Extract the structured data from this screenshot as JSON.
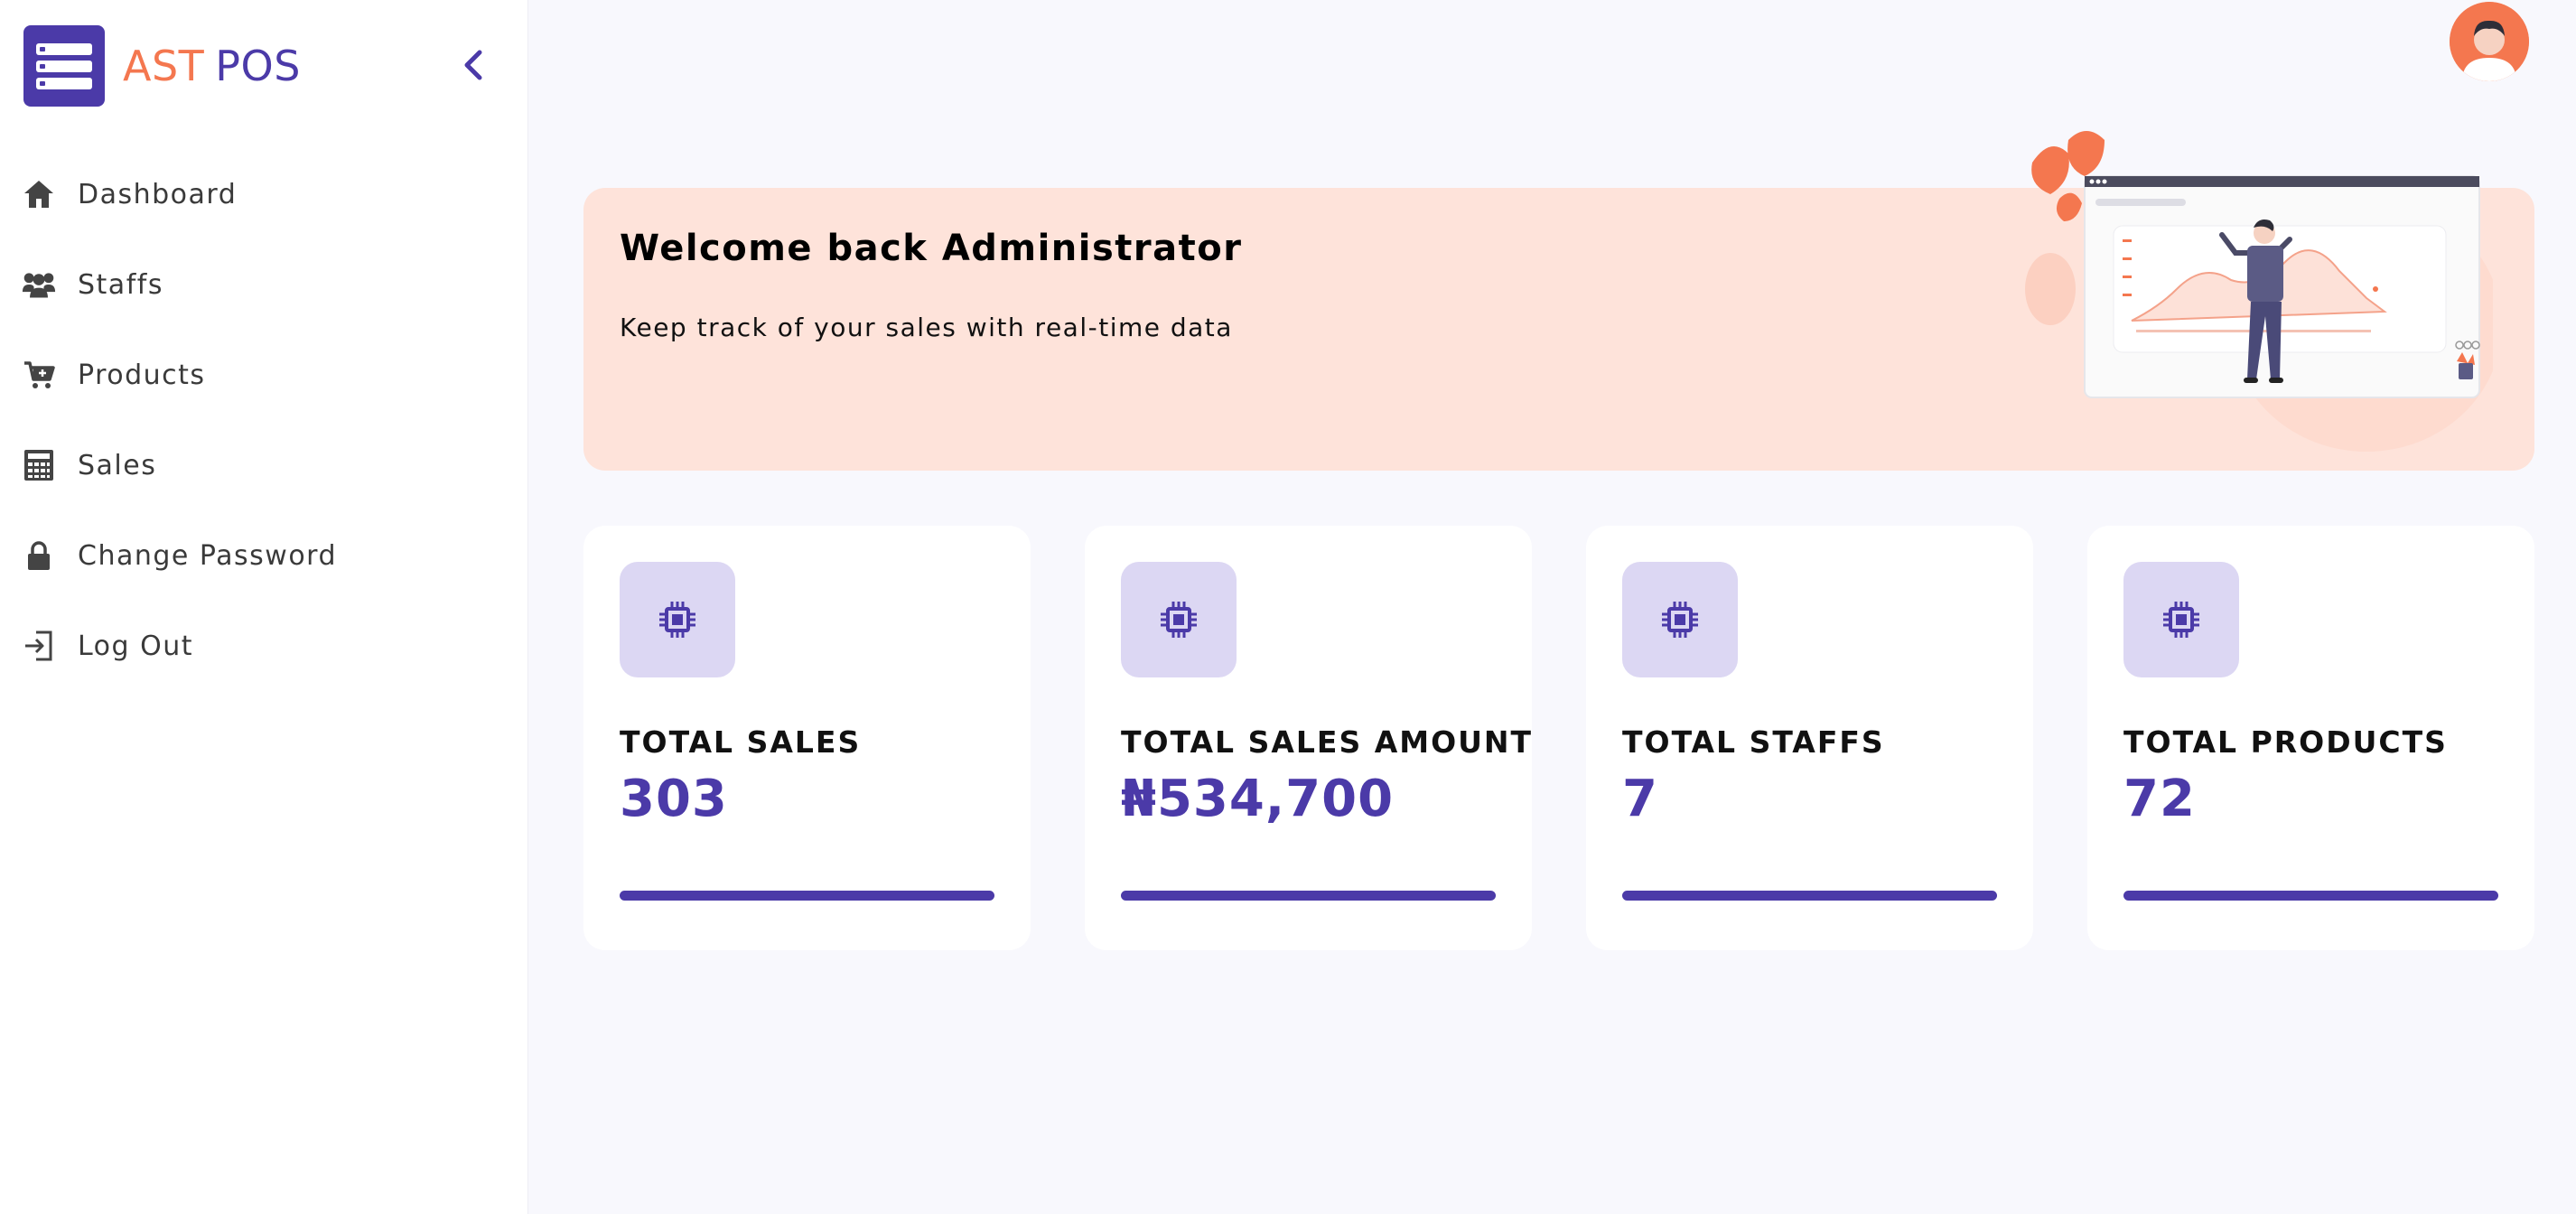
{
  "brand": {
    "name_part1": "AST",
    "name_part2": "POS"
  },
  "sidebar": {
    "items": [
      {
        "label": "Dashboard",
        "icon": "home-icon"
      },
      {
        "label": "Staffs",
        "icon": "users-icon"
      },
      {
        "label": "Products",
        "icon": "cart-icon"
      },
      {
        "label": "Sales",
        "icon": "calculator-icon"
      },
      {
        "label": "Change Password",
        "icon": "lock-icon"
      },
      {
        "label": "Log Out",
        "icon": "logout-icon"
      }
    ]
  },
  "banner": {
    "title": "Welcome back Administrator",
    "subtitle": "Keep track of your sales with real-time data"
  },
  "cards": [
    {
      "label": "TOTAL SALES",
      "value": "303",
      "icon": "chip-icon",
      "progress": 1.0
    },
    {
      "label": "TOTAL SALES AMOUNT",
      "value": "₦534,700",
      "icon": "chip-icon",
      "progress": 1.0
    },
    {
      "label": "TOTAL STAFFS",
      "value": "7",
      "icon": "chip-icon",
      "progress": 1.0
    },
    {
      "label": "TOTAL PRODUCTS",
      "value": "72",
      "icon": "chip-icon",
      "progress": 1.0
    }
  ],
  "colors": {
    "accent": "#4b3aa8",
    "brand_orange": "#f4774f",
    "banner_bg": "#fee3da",
    "icon_bg": "#dcd7f3",
    "page_bg": "#f8f8fd"
  }
}
